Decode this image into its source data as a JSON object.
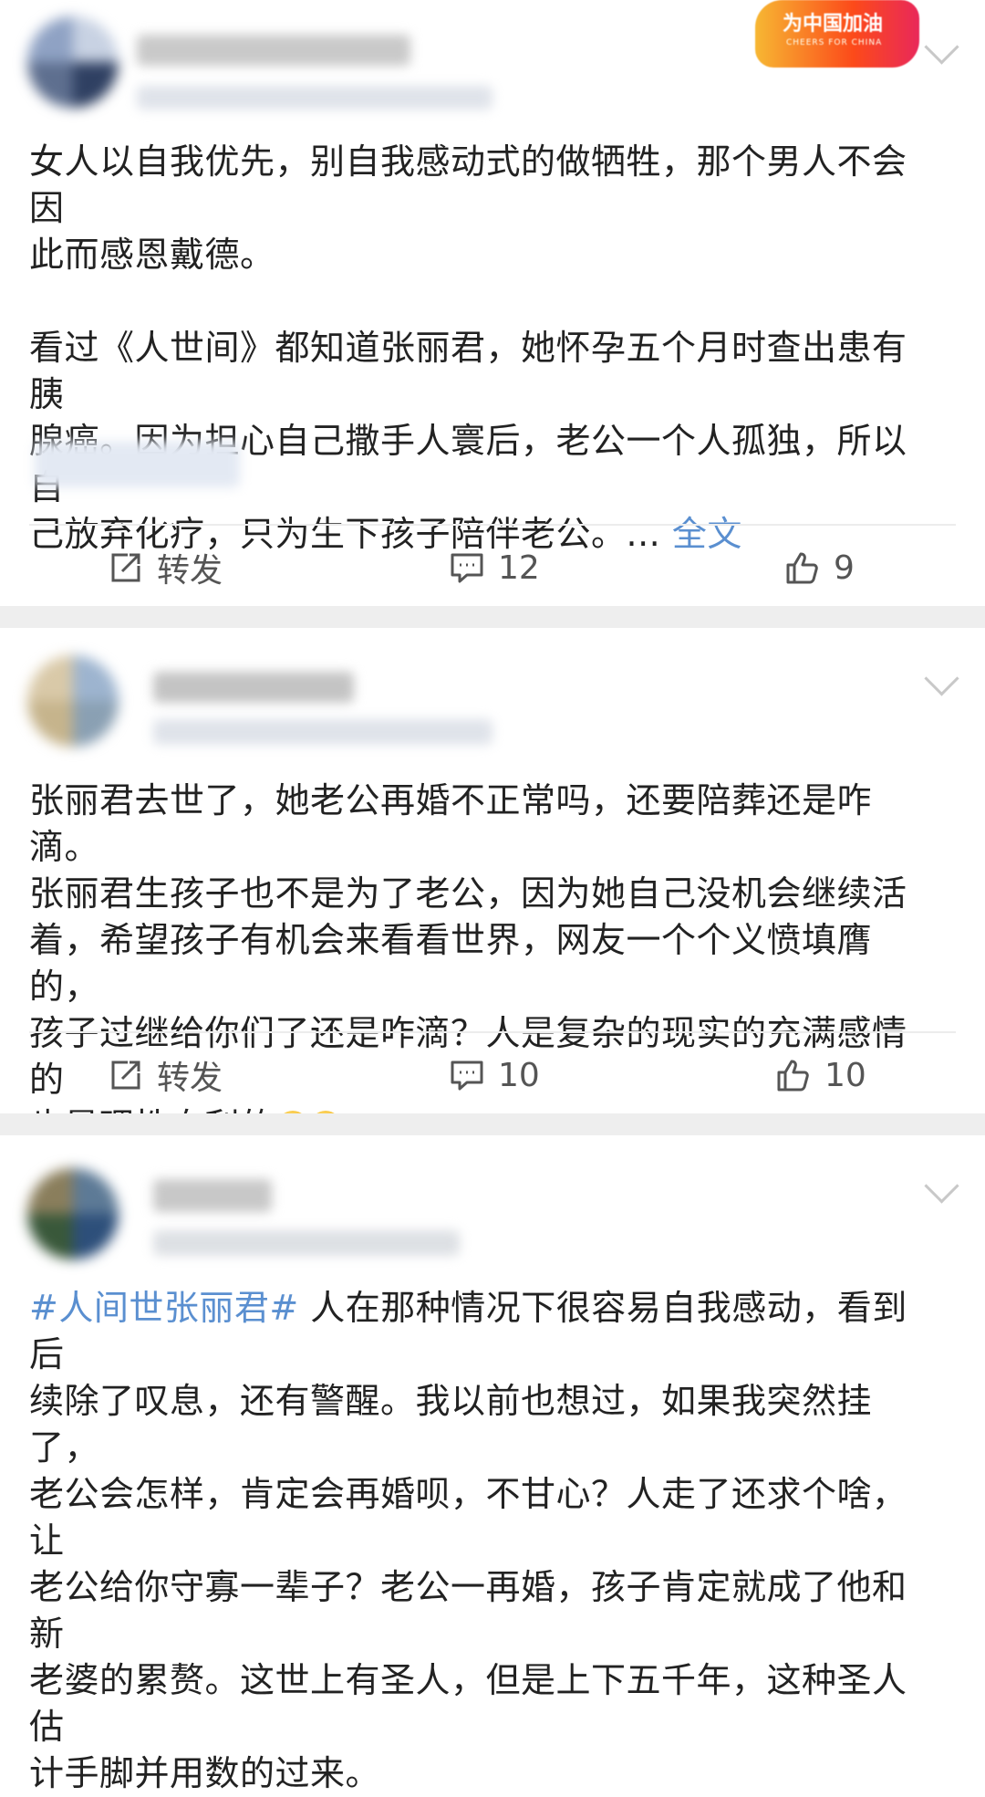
{
  "posts": [
    {
      "text": "女人以自我优先，别自我感动式的做牺牲，那个男人不会因\n此而感恩戴德。\n\n看过《人世间》都知道张丽君，她怀孕五个月时查出患有胰\n腺癌。因为担心自己撒手人寰后，老公一个人孤独，所以自\n己放弃化疗，只为生下孩子陪伴老公。...",
      "more_link": "全文",
      "badge_text": "为中国加油",
      "badge_sub": "CHEERS FOR CHINA",
      "repost_label": "转发",
      "comment_count": "12",
      "like_count": "9"
    },
    {
      "text": "张丽君去世了，她老公再婚不正常吗，还要陪葬还是咋滴。\n张丽君生孩子也不是为了老公，因为她自己没机会继续活\n着，希望孩子有机会来看看世界，网友一个个义愤填膺的，\n孩子过继给你们了还是咋滴？人是复杂的现实的充满感情的\n也是理性自利的",
      "repost_label": "转发",
      "comment_count": "10",
      "like_count": "10"
    },
    {
      "hashtag": "#人间世张丽君#",
      "text": " 人在那种情况下很容易自我感动，看到后\n续除了叹息，还有警醒。我以前也想过，如果我突然挂了，\n老公会怎样，肯定会再婚呗，不甘心？人走了还求个啥，让\n老公给你守寡一辈子？老公一再婚，孩子肯定就成了他和新\n老婆的累赘。这世上有圣人，但是上下五千年，这种圣人估\n计手脚并用数的过来。"
    }
  ],
  "icons": [
    "repost-icon",
    "comment-icon",
    "like-icon",
    "chevron-down-icon"
  ],
  "colors": {
    "link": "#5a8fd0",
    "separator": "#eeeeee",
    "text": "#222222"
  }
}
